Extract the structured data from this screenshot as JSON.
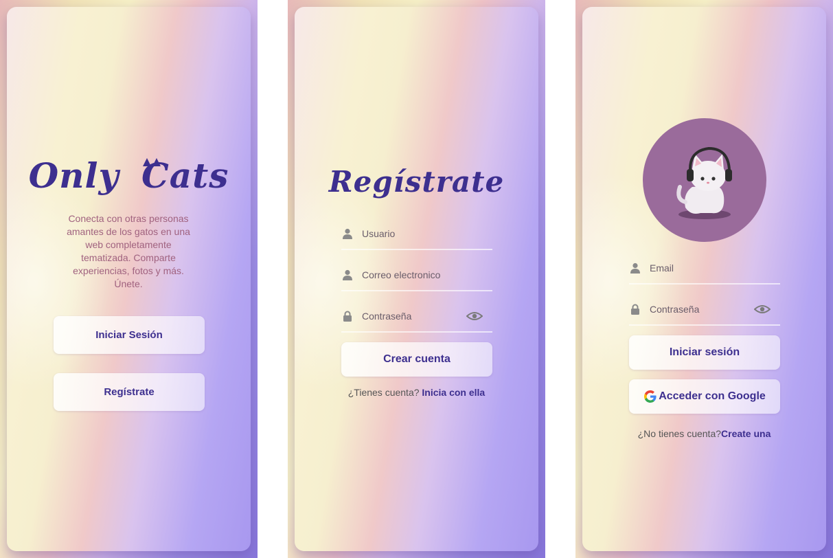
{
  "welcome": {
    "logo_part1": "Only",
    "logo_part2": "Cats",
    "description": "Conecta con otras personas amantes de los gatos en una web completamente tematizada. Comparte experiencias, fotos y más. Únete.",
    "login_button": "Iniciar Sesión",
    "register_button": "Regístrate"
  },
  "register": {
    "title": "Regístrate",
    "username_placeholder": "Usuario",
    "email_placeholder": "Correo electronico",
    "password_placeholder": "Contraseña",
    "submit_button": "Crear cuenta",
    "footer_text": "¿Tienes cuenta?",
    "footer_link": "Inicia con ella"
  },
  "login": {
    "email_placeholder": "Email",
    "password_placeholder": "Contraseña",
    "submit_button": "Iniciar sesión",
    "google_button": "Acceder con Google",
    "footer_text": "¿No tienes cuenta?",
    "footer_link": "Create una"
  },
  "colors": {
    "brand": "#3d2f8f",
    "description_text": "#a0627f",
    "avatar_bg": "#9a6b9b"
  }
}
